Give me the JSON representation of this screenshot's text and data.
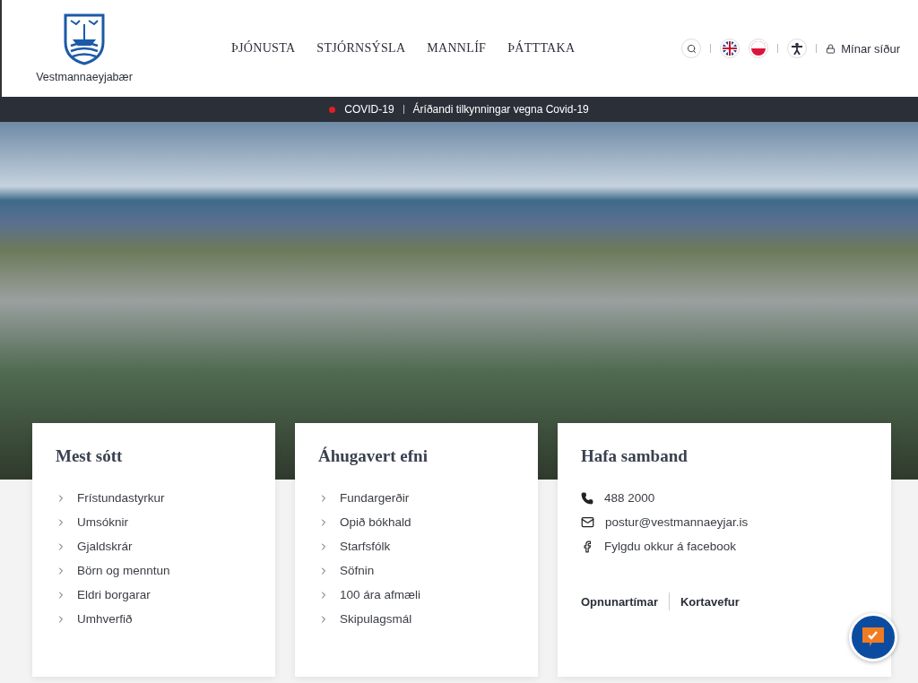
{
  "header": {
    "logo_text": "Vestmannaeyjabær",
    "nav": [
      {
        "label": "ÞJÓNUSTA"
      },
      {
        "label": "STJÓRNSÝSLA"
      },
      {
        "label": "MANNLÍF"
      },
      {
        "label": "ÞÁTTTAKA"
      }
    ],
    "my_pages": "Mínar síður"
  },
  "alert_bar": {
    "tag": "COVID-19",
    "color": "#e41e26",
    "message": "Áríðandi tilkynningar vegna Covid-19"
  },
  "cards": [
    {
      "title": "Mest sótt",
      "links": [
        "Frístundastyrkur",
        "Umsóknir",
        "Gjaldskrár",
        "Börn og menntun",
        "Eldri borgarar",
        "Umhverfið"
      ]
    },
    {
      "title": "Áhugavert efni",
      "links": [
        "Fundargerðir",
        "Opið bókhald",
        "Starfsfólk",
        "Söfnin",
        "100 ára afmæli",
        "Skipulagsmál"
      ]
    }
  ],
  "contact": {
    "title": "Hafa samband",
    "items": [
      {
        "kind": "phone",
        "text": "488 2000"
      },
      {
        "kind": "email",
        "text": "postur@vestmannaeyjar.is"
      },
      {
        "kind": "facebook",
        "text": "Fylgdu okkur á facebook"
      }
    ],
    "links": [
      "Opnunartímar",
      "Kortavefur"
    ]
  }
}
